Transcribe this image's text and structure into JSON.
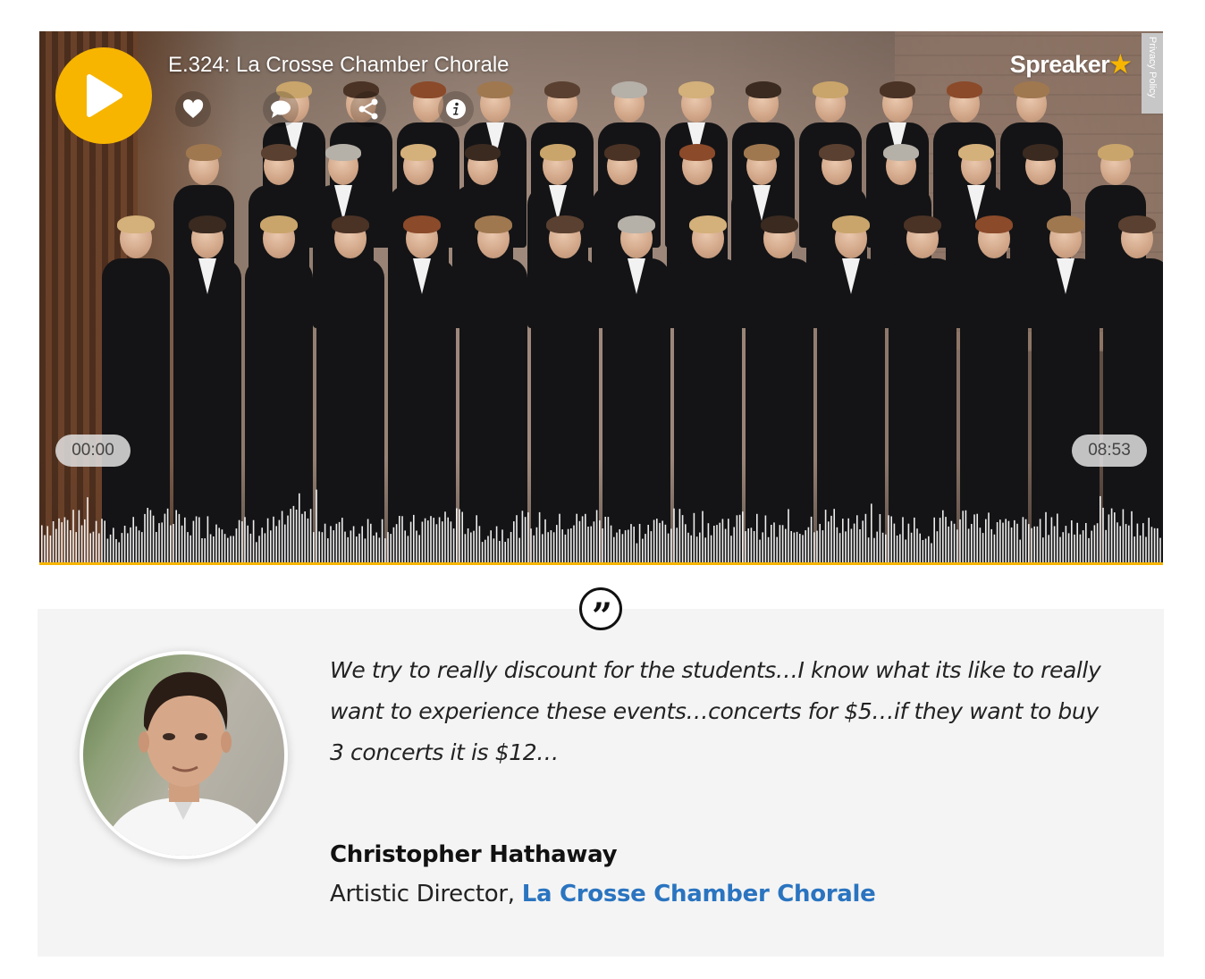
{
  "player": {
    "episode_title": "E.324: La Crosse Chamber Chorale",
    "brand": "Spreaker",
    "brand_star": "★",
    "privacy_label": "Privacy Policy",
    "current_time": "00:00",
    "duration": "08:53",
    "playback_progress": 0,
    "accent_color": "#f7b500",
    "actions": [
      {
        "icon": "heart-icon",
        "label": "Like"
      },
      {
        "icon": "comment-icon",
        "label": "Comment"
      },
      {
        "icon": "share-icon",
        "label": "Share"
      },
      {
        "icon": "info-icon",
        "label": "Info"
      }
    ]
  },
  "testimonial": {
    "quote_icon": "quote-icon",
    "quote": "We try to really discount for the students…I know what its like to really want to experience these events…concerts for $5…if they want to buy 3 concerts it is $12…",
    "author_name": "Christopher Hathaway",
    "author_role_prefix": "Artistic Director, ",
    "author_org_link": "La Crosse Chamber Chorale",
    "link_color": "#2a74c0",
    "background_color": "#f4f4f4"
  }
}
